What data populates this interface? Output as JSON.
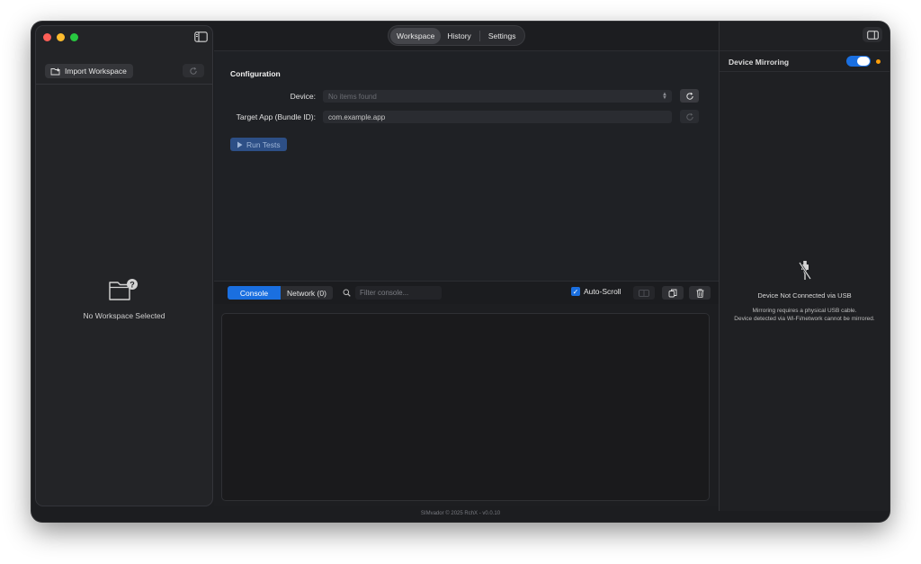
{
  "sidebar": {
    "import_label": "Import Workspace",
    "empty_label": "No Workspace Selected"
  },
  "tabs": [
    {
      "label": "Workspace",
      "active": true
    },
    {
      "label": "History",
      "active": false
    },
    {
      "label": "Settings",
      "active": false
    }
  ],
  "config": {
    "title": "Configuration",
    "device_label": "Device:",
    "device_placeholder": "No items found",
    "target_label": "Target App (Bundle ID):",
    "target_value": "com.example.app",
    "run_label": "Run Tests"
  },
  "console": {
    "tab_console": "Console",
    "tab_network": "Network (0)",
    "filter_placeholder": "Filter console...",
    "autoscroll_label": "Auto-Scroll",
    "autoscroll_checked": true
  },
  "right_panel": {
    "title": "Device Mirroring",
    "mirroring_enabled": true,
    "status_color": "#ff9f0a",
    "not_connected_title": "Device Not Connected via USB",
    "message_line1": "Mirroring requires a physical USB cable.",
    "message_line2": "Device detected via Wi-Fi/network cannot be mirrored."
  },
  "footer": "SIMvador © 2025 RchX - v0.0.10",
  "colors": {
    "accent": "#1a6fe0",
    "run_button": "#2d4f86",
    "window_bg": "#1c1d20"
  }
}
